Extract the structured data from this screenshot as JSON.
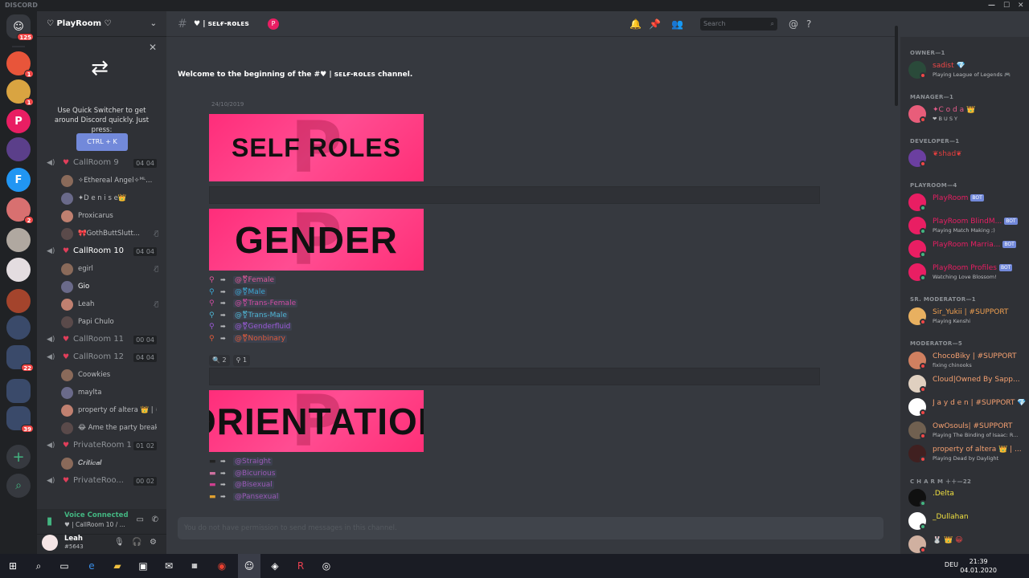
{
  "window": {
    "app_title": "DISCORD",
    "minimize": "—",
    "maximize": "☐",
    "close": "✕"
  },
  "guilds": {
    "home_badge": "125",
    "items": [
      {
        "badge": "1",
        "color": "#e8553a",
        "icon": "guild-icon"
      },
      {
        "badge": "1",
        "color": "#d9a441",
        "icon": "guild-icon"
      },
      {
        "badge": "",
        "color": "#e91e63",
        "icon": "guild-icon",
        "letter": "P"
      },
      {
        "badge": "",
        "color": "#5b3f8a",
        "icon": "guild-icon"
      },
      {
        "badge": "",
        "color": "#2196f3",
        "icon": "guild-icon",
        "letter": "F"
      },
      {
        "badge": "2",
        "color": "#d87070",
        "icon": "guild-icon"
      },
      {
        "badge": "",
        "color": "#b0a8a0",
        "icon": "guild-icon"
      },
      {
        "badge": "",
        "color": "#e4dde0",
        "icon": "guild-icon"
      },
      {
        "badge": "",
        "color": "#a4442c",
        "icon": "guild-icon"
      },
      {
        "badge": "",
        "color": "#3a4a6a",
        "icon": "guild-icon"
      },
      {
        "badge": "22",
        "color": "#3a4a6a",
        "icon": "guild-folder-icon"
      },
      {
        "badge": "",
        "color": "#3a4a6a",
        "icon": "guild-folder-icon"
      },
      {
        "badge": "39",
        "color": "#3a4a6a",
        "icon": "guild-folder-icon"
      }
    ],
    "add_label": "+",
    "explore_label": "⌕"
  },
  "server": {
    "name": "♡ PlayRoom ♡"
  },
  "quick_switcher": {
    "text": "Use Quick Switcher to get around Discord quickly. Just press:",
    "button": "CTRL + K"
  },
  "voice_channels": [
    {
      "name": "CallRoom 9",
      "count": "04 04",
      "active": false,
      "users": [
        {
          "name": "✧Ethereal Angel✧ᴹᴸ...",
          "muted": false
        },
        {
          "name": "✦D e n i s e👑",
          "muted": false
        },
        {
          "name": "Proxicarus",
          "muted": false
        },
        {
          "name": "🎀GothButtSlutt...",
          "muted": true
        }
      ]
    },
    {
      "name": "CallRoom 10",
      "count": "04 04",
      "active": true,
      "users": [
        {
          "name": "egirl",
          "muted": true
        },
        {
          "name": "Gio",
          "muted": false,
          "white": true
        },
        {
          "name": "Leah",
          "muted": true
        },
        {
          "name": "Papi Chulo",
          "muted": false
        }
      ]
    },
    {
      "name": "CallRoom 11",
      "count": "00 04",
      "active": false,
      "users": []
    },
    {
      "name": "CallRoom 12",
      "count": "04 04",
      "active": false,
      "users": [
        {
          "name": "Coowkies",
          "muted": false
        },
        {
          "name": "maylta",
          "muted": false
        },
        {
          "name": "property of altera 👑 | #...",
          "muted": false
        },
        {
          "name": "😂 Ame the party break...",
          "muted": false
        }
      ]
    },
    {
      "name": "PrivateRoom 1",
      "count": "01 02",
      "active": false,
      "users": [
        {
          "name": "𝑪𝒓𝒊𝒕𝒊𝒄𝒂𝒍",
          "muted": false
        }
      ]
    },
    {
      "name": "PrivateRoo...",
      "count": "00 02",
      "active": false,
      "users": []
    }
  ],
  "voice_connected": {
    "status": "Voice Connected",
    "channel": "♥ | CallRoom 10 / ..."
  },
  "user": {
    "name": "Leah",
    "discriminator": "#5643"
  },
  "channel": {
    "name": "sᴇʟғ-ʀᴏʟᴇs",
    "badge": "P"
  },
  "header": {
    "search_placeholder": "Search"
  },
  "welcome": {
    "prefix": "Welcome to the beginning of the #",
    "channel": " sᴇʟғ-ʀᴏʟᴇs",
    "suffix": " channel."
  },
  "message": {
    "date": "24/10/2019"
  },
  "banners": {
    "self_roles": "SELF ROLES",
    "gender": "GENDER",
    "orientation": "ORIENTATION",
    "watermark": "P"
  },
  "gender_roles": [
    {
      "icon": "⚲",
      "label": "@⚧Female",
      "color": "#e0589a"
    },
    {
      "icon": "⚲",
      "label": "@⚧Male",
      "color": "#3ba8d4"
    },
    {
      "icon": "⚲",
      "label": "@⚧Trans-Female",
      "color": "#d04ca3"
    },
    {
      "icon": "⚲",
      "label": "@⚧Trans-Male",
      "color": "#4fb6d4"
    },
    {
      "icon": "⚲",
      "label": "@⚧Genderfluid",
      "color": "#9b59d6"
    },
    {
      "icon": "⚲",
      "label": "@⚧Nonbinary",
      "color": "#e05a3a"
    }
  ],
  "reactions": [
    {
      "emoji": "🔍",
      "count": "2"
    },
    {
      "emoji": "⚲",
      "count": "1"
    }
  ],
  "orientation_roles": [
    {
      "label": "@Straight",
      "color": "#9b59b6"
    },
    {
      "label": "@Bicurious",
      "color": "#9b59b6"
    },
    {
      "label": "@Bisexual",
      "color": "#9b59b6"
    },
    {
      "label": "@Pansexual",
      "color": "#9b59b6"
    }
  ],
  "input": {
    "placeholder": "You do not have permission to send messages in this channel."
  },
  "members": {
    "groups": [
      {
        "title": "OWNER—1",
        "members": [
          {
            "name": "sadist 💎",
            "sub": "Playing League of Legends 🎮",
            "color": "#f04747",
            "avatar": "#2a4a3a",
            "status": "#f04747"
          }
        ]
      },
      {
        "title": "MANAGER—1",
        "members": [
          {
            "name": "✦C o d a 👑",
            "sub": "❤ B U S Y",
            "color": "#e65c8a",
            "avatar": "#e85d7a",
            "status": "#f04747"
          }
        ]
      },
      {
        "title": "DEVELOPER—1",
        "members": [
          {
            "name": "❦shad❦",
            "sub": "",
            "color": "#e03e3e",
            "avatar": "#6b3fa0",
            "status": "#f04747"
          }
        ]
      },
      {
        "title": "PLAYROOM—4",
        "members": [
          {
            "name": "PlayRoom",
            "sub": "",
            "bot": "BOT",
            "color": "#e91e63",
            "avatar": "#e91e63",
            "status": "#43b581"
          },
          {
            "name": "PlayRoom BlindM...",
            "sub": "Playing Match Making ;)",
            "bot": "BOT",
            "color": "#e91e63",
            "avatar": "#e91e63",
            "status": "#43b581"
          },
          {
            "name": "PlayRoom Marria...",
            "sub": "",
            "bot": "BOT",
            "color": "#e91e63",
            "avatar": "#e91e63",
            "status": "#43b581"
          },
          {
            "name": "PlayRoom Profiles",
            "sub": "Watching Love Blossom!",
            "bot": "BOT",
            "color": "#e91e63",
            "avatar": "#e91e63",
            "status": "#43b581"
          }
        ]
      },
      {
        "title": "SR. MODERATOR—1",
        "members": [
          {
            "name": "Sir_Yukii | #SUPPORT",
            "sub": "Playing Kenshi",
            "color": "#f0a050",
            "avatar": "#e8b060",
            "status": "#f04747"
          }
        ]
      },
      {
        "title": "MODERATOR—5",
        "members": [
          {
            "name": "ChocoBiky | #SUPPORT",
            "sub": "fixing chinooks",
            "color": "#f5a070",
            "avatar": "#d08060",
            "status": "#f04747"
          },
          {
            "name": "Cloud|Owned By Sapp...",
            "sub": "",
            "color": "#f5a070",
            "avatar": "#e0d0c0",
            "status": "#f04747"
          },
          {
            "name": "J a y d e n | #SUPPORT 💎",
            "sub": "",
            "color": "#f5a070",
            "avatar": "#ffffff",
            "status": "#f04747"
          },
          {
            "name": "OwOsouls| #SUPPORT",
            "sub": "Playing The Binding of Isaac: R...",
            "color": "#f5a070",
            "avatar": "#706050",
            "status": "#f04747"
          },
          {
            "name": "property of altera 👑 | ...",
            "sub": "Playing Dead by Daylight",
            "color": "#f5a070",
            "avatar": "#402020",
            "status": "#f04747"
          }
        ]
      },
      {
        "title": "C H A R M ＋＋—22",
        "members": [
          {
            "name": ".Delta",
            "sub": "",
            "color": "#f0e040",
            "avatar": "#101010",
            "status": "#43b581"
          },
          {
            "name": "_Dullahan",
            "sub": "",
            "color": "#f0e040",
            "avatar": "#ffffff",
            "status": "#43b581"
          },
          {
            "name": "🐰 👑 😀",
            "sub": "",
            "color": "#f04747",
            "avatar": "#d0b0a0",
            "status": "#f04747"
          }
        ]
      }
    ]
  },
  "taskbar": {
    "start": "⊞",
    "search": "⌕",
    "lang": "DEU",
    "time": "21:39",
    "date": "04.01.2020"
  }
}
